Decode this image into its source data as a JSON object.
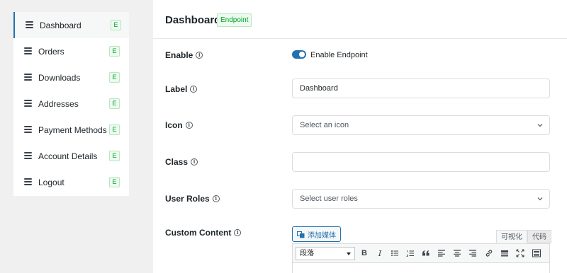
{
  "sidebar": {
    "items": [
      {
        "label": "Dashboard",
        "badge": "E",
        "active": true
      },
      {
        "label": "Orders",
        "badge": "E"
      },
      {
        "label": "Downloads",
        "badge": "E"
      },
      {
        "label": "Addresses",
        "badge": "E"
      },
      {
        "label": "Payment Methods",
        "badge": "E"
      },
      {
        "label": "Account Details",
        "badge": "E"
      },
      {
        "label": "Logout",
        "badge": "E"
      }
    ]
  },
  "header": {
    "title": "Dashboard",
    "badge": "Endpoint"
  },
  "form": {
    "enable": {
      "label": "Enable",
      "toggle_label": "Enable Endpoint",
      "enabled": true
    },
    "label": {
      "label": "Label",
      "value": "Dashboard"
    },
    "icon": {
      "label": "Icon",
      "placeholder": "Select an icon"
    },
    "class": {
      "label": "Class",
      "value": ""
    },
    "user_roles": {
      "label": "User Roles",
      "placeholder": "Select user roles"
    },
    "custom_content": {
      "label": "Custom Content",
      "add_media": "添加媒体",
      "tab_visual": "可视化",
      "tab_code": "代码",
      "format_value": "段落"
    }
  },
  "info_glyph": "i",
  "colors": {
    "accent": "#2271b1",
    "badge_green": "#00a32a"
  }
}
